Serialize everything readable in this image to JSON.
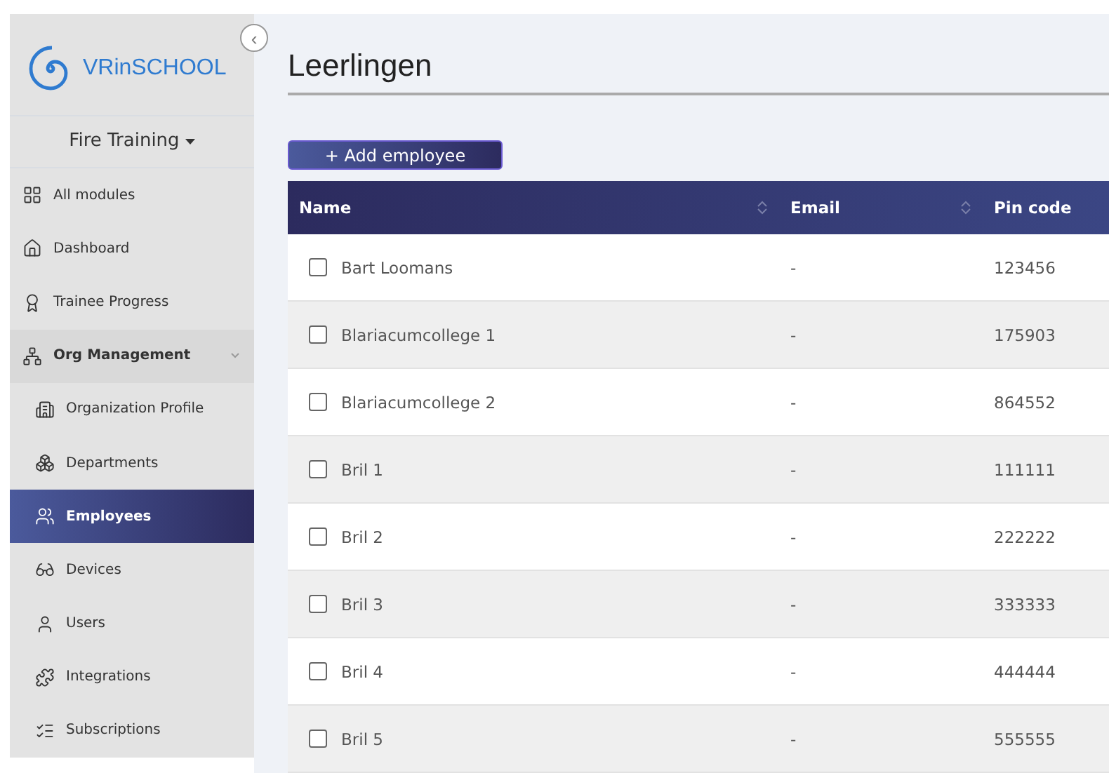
{
  "sidebar": {
    "logo": "VRinSCHOOL",
    "collapse_button": "‹",
    "module_selector": "Fire Training",
    "items": [
      {
        "label": "All modules",
        "selected": false
      },
      {
        "label": "Dashboard",
        "selected": false
      },
      {
        "label": "Trainee Progress",
        "selected": false
      },
      {
        "label": "Org Management",
        "selected": false,
        "expanded": true,
        "children": [
          {
            "label": "Organization Profile",
            "selected": false
          },
          {
            "label": "Departments",
            "selected": false
          },
          {
            "label": "Employees",
            "selected": true
          },
          {
            "label": "Devices",
            "selected": false
          },
          {
            "label": "Users",
            "selected": false
          },
          {
            "label": "Integrations",
            "selected": false
          },
          {
            "label": "Subscriptions",
            "selected": false
          }
        ]
      }
    ]
  },
  "page_title": "Leerlingen",
  "add_button": "+ Add employee",
  "table": {
    "columns": [
      {
        "label": "Name",
        "sortable": true
      },
      {
        "label": "Email",
        "sortable": true
      },
      {
        "label": "Pin code",
        "sortable": false
      }
    ],
    "rows": [
      {
        "checked": false,
        "cells": [
          "Bart Loomans",
          "-",
          "123456"
        ]
      },
      {
        "checked": false,
        "cells": [
          "Blariacumcollege 1",
          "-",
          "175903"
        ]
      },
      {
        "checked": false,
        "cells": [
          "Blariacumcollege 2",
          "-",
          "864552"
        ]
      },
      {
        "checked": false,
        "cells": [
          "Bril 1",
          "-",
          "111111"
        ]
      },
      {
        "checked": false,
        "cells": [
          "Bril 2",
          "-",
          "222222"
        ]
      },
      {
        "checked": false,
        "cells": [
          "Bril 3",
          "-",
          "333333"
        ]
      },
      {
        "checked": false,
        "cells": [
          "Bril 4",
          "-",
          "444444"
        ]
      },
      {
        "checked": false,
        "cells": [
          "Bril 5",
          "-",
          "555555"
        ]
      }
    ]
  }
}
